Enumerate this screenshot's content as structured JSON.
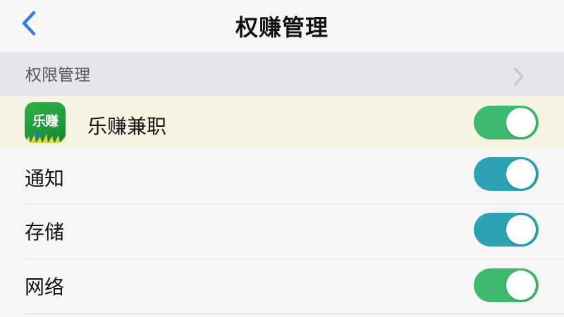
{
  "header": {
    "title": "权赚管理",
    "back_icon": "chevron-left-icon",
    "accent_color": "#2e7cf6"
  },
  "section": {
    "label": "权限管理",
    "chevron_icon": "chevron-right-icon"
  },
  "app": {
    "name": "乐赚兼职",
    "icon_text": "乐赚",
    "enabled": true,
    "toggle_color": "#3dba6e"
  },
  "permissions": [
    {
      "label": "通知",
      "enabled": true,
      "toggle_color": "#2ba3b4"
    },
    {
      "label": "存储",
      "enabled": true,
      "toggle_color": "#2ba3b4"
    },
    {
      "label": "网络",
      "enabled": true,
      "toggle_color": "#3dba6e"
    }
  ]
}
